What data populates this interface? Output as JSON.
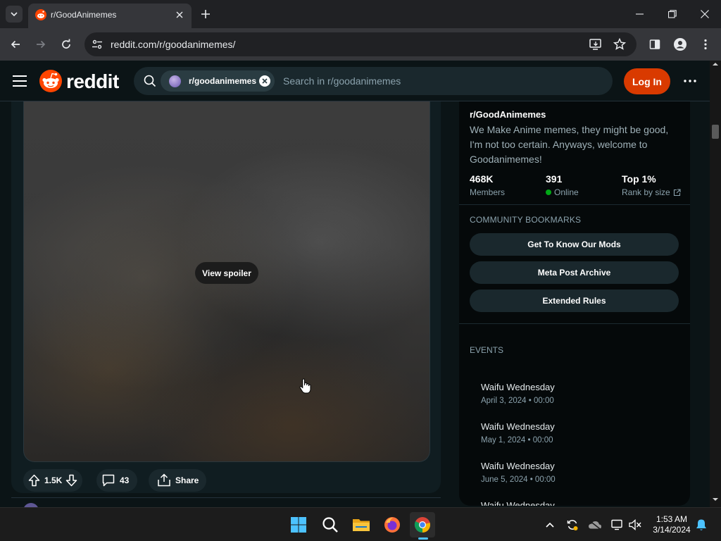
{
  "browser": {
    "tab_title": "r/GoodAnimemes",
    "url": "reddit.com/r/goodanimemes/"
  },
  "header": {
    "wordmark": "reddit",
    "search_chip": "r/goodanimemes",
    "search_placeholder": "Search in r/goodanimemes",
    "login_label": "Log In"
  },
  "post": {
    "spoiler_label": "View spoiler",
    "upvotes": "1.5K",
    "comments": "43",
    "share_label": "Share"
  },
  "sidebar": {
    "name": "r/GoodAnimemes",
    "description": "We Make Anime memes, they might be good, I'm not too certain. Anyways, welcome to Goodanimemes!",
    "stats": [
      {
        "value": "468K",
        "label": "Members"
      },
      {
        "value": "391",
        "label": "Online"
      },
      {
        "value": "Top 1%",
        "label": "Rank by size"
      }
    ],
    "bookmarks_title": "COMMUNITY BOOKMARKS",
    "bookmarks": [
      "Get To Know Our Mods",
      "Meta Post Archive",
      "Extended Rules"
    ],
    "events_title": "EVENTS",
    "events": [
      {
        "name": "Waifu Wednesday",
        "date": "April 3, 2024 • 00:00"
      },
      {
        "name": "Waifu Wednesday",
        "date": "May 1, 2024 • 00:00"
      },
      {
        "name": "Waifu Wednesday",
        "date": "June 5, 2024 • 00:00"
      },
      {
        "name": "Waifu Wednesday",
        "date": ""
      }
    ]
  },
  "taskbar": {
    "time": "1:53 AM",
    "date": "3/14/2024"
  },
  "colors": {
    "brand": "#ff4500",
    "login": "#d93a00",
    "online": "#01a816"
  }
}
